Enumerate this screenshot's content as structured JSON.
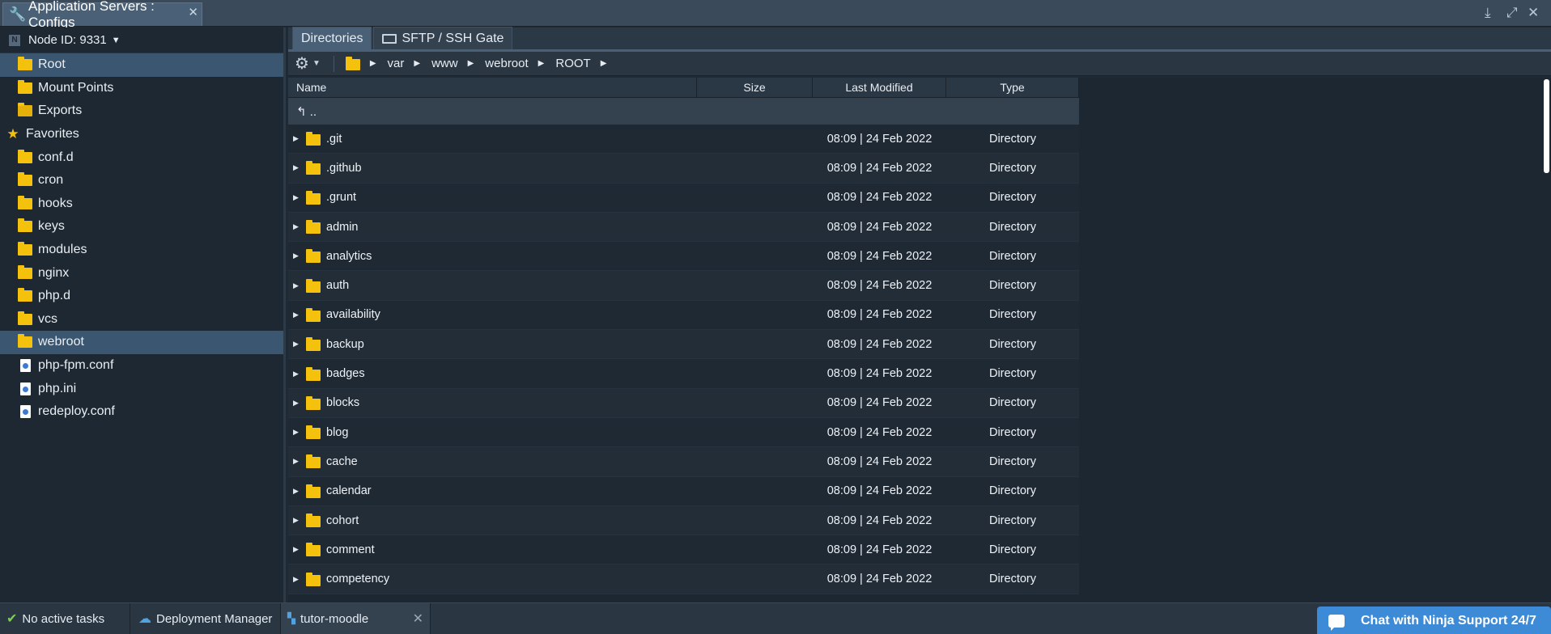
{
  "window": {
    "title": "Application Servers : Configs",
    "close": "✕",
    "controls": [
      "⤓",
      "⤢",
      "✕"
    ]
  },
  "sidebar": {
    "node_label": "Node ID: 9331",
    "items": [
      {
        "label": "Root",
        "icon": "folder-icon",
        "selected": true
      },
      {
        "label": "Mount Points",
        "icon": "folder-icon"
      },
      {
        "label": "Exports",
        "icon": "exports-folder-icon"
      }
    ],
    "favorites_label": "Favorites",
    "favorites": [
      {
        "label": "conf.d",
        "icon": "folder-icon"
      },
      {
        "label": "cron",
        "icon": "folder-icon"
      },
      {
        "label": "hooks",
        "icon": "folder-icon"
      },
      {
        "label": "keys",
        "icon": "folder-icon"
      },
      {
        "label": "modules",
        "icon": "folder-icon"
      },
      {
        "label": "nginx",
        "icon": "folder-icon"
      },
      {
        "label": "php.d",
        "icon": "folder-icon"
      },
      {
        "label": "vcs",
        "icon": "folder-icon"
      },
      {
        "label": "webroot",
        "icon": "folder-icon",
        "selected": true
      },
      {
        "label": "php-fpm.conf",
        "icon": "config-file-icon"
      },
      {
        "label": "php.ini",
        "icon": "config-file-icon"
      },
      {
        "label": "redeploy.conf",
        "icon": "config-file-icon"
      }
    ]
  },
  "tabs": [
    {
      "label": "Directories",
      "active": true
    },
    {
      "label": "SFTP / SSH Gate",
      "active": false
    }
  ],
  "breadcrumb": [
    "var",
    "www",
    "webroot",
    "ROOT"
  ],
  "grid": {
    "columns": [
      "Name",
      "Size",
      "Last Modified",
      "Type"
    ],
    "updir": "↰  ..",
    "rows": [
      {
        "name": ".git",
        "size": "",
        "modified": "08:09 | 24 Feb 2022",
        "type": "Directory"
      },
      {
        "name": ".github",
        "size": "",
        "modified": "08:09 | 24 Feb 2022",
        "type": "Directory"
      },
      {
        "name": ".grunt",
        "size": "",
        "modified": "08:09 | 24 Feb 2022",
        "type": "Directory"
      },
      {
        "name": "admin",
        "size": "",
        "modified": "08:09 | 24 Feb 2022",
        "type": "Directory"
      },
      {
        "name": "analytics",
        "size": "",
        "modified": "08:09 | 24 Feb 2022",
        "type": "Directory"
      },
      {
        "name": "auth",
        "size": "",
        "modified": "08:09 | 24 Feb 2022",
        "type": "Directory"
      },
      {
        "name": "availability",
        "size": "",
        "modified": "08:09 | 24 Feb 2022",
        "type": "Directory"
      },
      {
        "name": "backup",
        "size": "",
        "modified": "08:09 | 24 Feb 2022",
        "type": "Directory"
      },
      {
        "name": "badges",
        "size": "",
        "modified": "08:09 | 24 Feb 2022",
        "type": "Directory"
      },
      {
        "name": "blocks",
        "size": "",
        "modified": "08:09 | 24 Feb 2022",
        "type": "Directory"
      },
      {
        "name": "blog",
        "size": "",
        "modified": "08:09 | 24 Feb 2022",
        "type": "Directory"
      },
      {
        "name": "cache",
        "size": "",
        "modified": "08:09 | 24 Feb 2022",
        "type": "Directory"
      },
      {
        "name": "calendar",
        "size": "",
        "modified": "08:09 | 24 Feb 2022",
        "type": "Directory"
      },
      {
        "name": "cohort",
        "size": "",
        "modified": "08:09 | 24 Feb 2022",
        "type": "Directory"
      },
      {
        "name": "comment",
        "size": "",
        "modified": "08:09 | 24 Feb 2022",
        "type": "Directory"
      },
      {
        "name": "competency",
        "size": "",
        "modified": "08:09 | 24 Feb 2022",
        "type": "Directory"
      }
    ]
  },
  "statusbar": {
    "tasks": "No active tasks",
    "deployment": "Deployment Manager",
    "env": "tutor-moodle",
    "chat": "Chat with Ninja Support 24/7"
  },
  "colors": {
    "accent": "#3d8bd6",
    "selection": "#3b5670",
    "folder": "#f4c20d"
  }
}
